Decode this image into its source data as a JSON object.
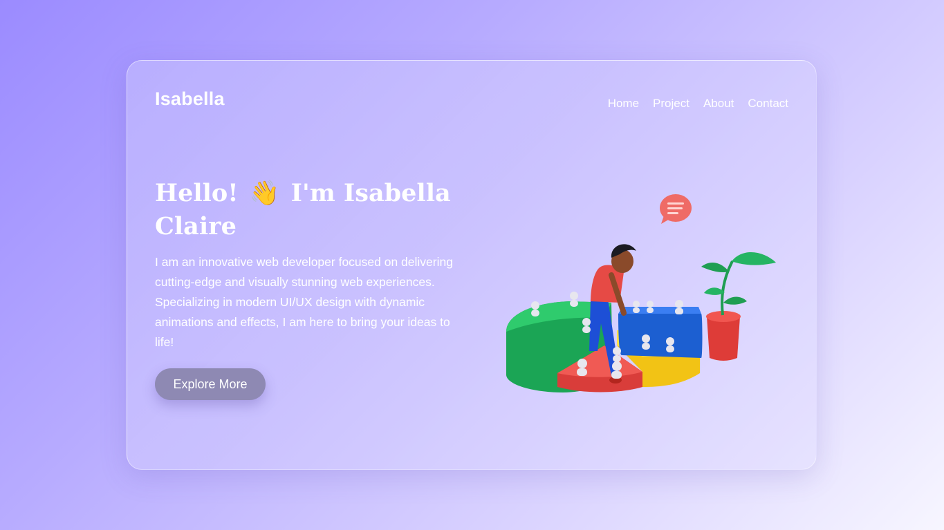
{
  "header": {
    "logo": "Isabella",
    "nav": [
      "Home",
      "Project",
      "About",
      "Contact"
    ]
  },
  "hero": {
    "title_before": "Hello!",
    "title_emoji": "👋",
    "title_after": "I'm Isabella Claire",
    "description": "I am an innovative web developer focused on delivering cutting-edge and visually stunning web experiences. Specializing in modern UI/UX design with dynamic animations and effects, I am here to bring your ideas to life!",
    "cta_label": "Explore More"
  },
  "illustration": {
    "icon": "woman-with-3d-pie-chart-illustration"
  },
  "colors": {
    "background_start": "#9b8bff",
    "background_end": "#f7f6ff",
    "button": "#8e89b3",
    "text": "#ffffff"
  }
}
